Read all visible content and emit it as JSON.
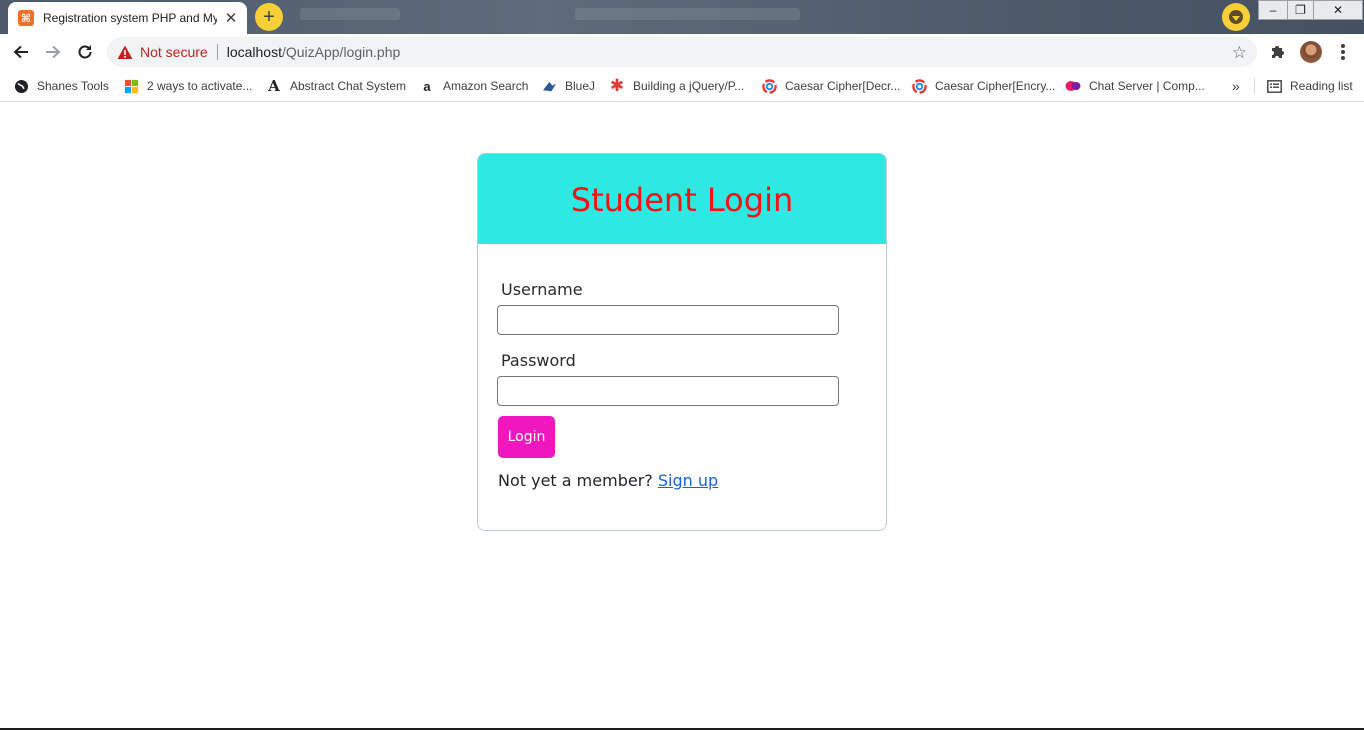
{
  "browser": {
    "tab_title": "Registration system PHP and My",
    "not_secure": "Not secure",
    "url_host": "localhost",
    "url_path": "/QuizApp/login.php"
  },
  "bookmarks": [
    {
      "label": "Shanes Tools",
      "icon": "globe-icon",
      "color": "#202124"
    },
    {
      "label": "2 ways to activate...",
      "icon": "windows-icon",
      "color": "#0078d4"
    },
    {
      "label": "Abstract Chat System",
      "icon": "letter-a-icon",
      "color": "#202124"
    },
    {
      "label": "Amazon Search",
      "icon": "amazon-icon",
      "color": "#ff9900"
    },
    {
      "label": "BlueJ",
      "icon": "bluej-icon",
      "color": "#2b5797"
    },
    {
      "label": "Building a jQuery/P...",
      "icon": "asterisk-icon",
      "color": "#e53935"
    },
    {
      "label": "Caesar Cipher[Decr...",
      "icon": "swirl-icon",
      "color": "#e53935"
    },
    {
      "label": "Caesar Cipher[Encry...",
      "icon": "swirl-icon",
      "color": "#e53935"
    },
    {
      "label": "Chat Server | Comp...",
      "icon": "chat-icon",
      "color": "#e91e63"
    }
  ],
  "reading_list": "Reading list",
  "login": {
    "title": "Student Login",
    "username_label": "Username",
    "password_label": "Password",
    "button": "Login",
    "prompt": "Not yet a member?",
    "signup_link": "Sign up"
  },
  "colors": {
    "header_bg": "#2ee8e4",
    "title_color": "#f01414",
    "button_bg": "#f017c1",
    "link_color": "#1565d8"
  }
}
